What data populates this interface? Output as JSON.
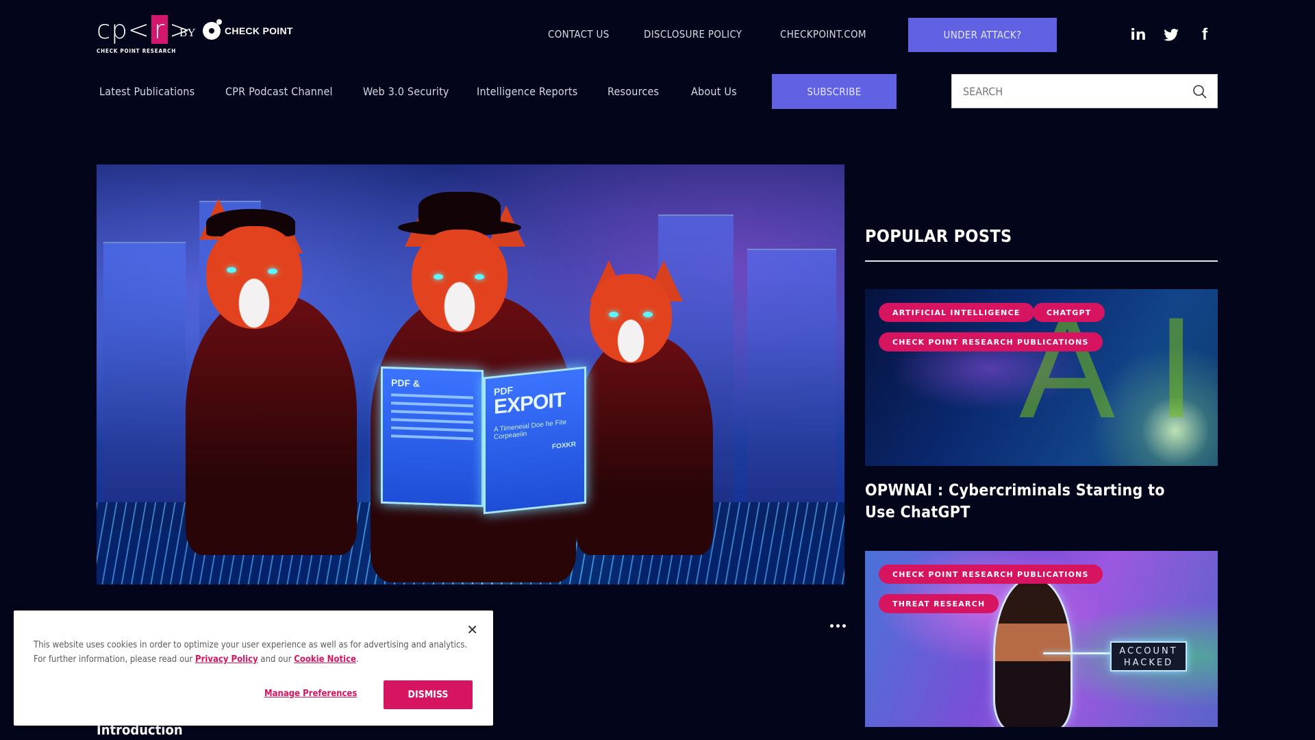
{
  "brand": {
    "logo_text_prefix": "cp<",
    "logo_text_r": "r",
    "logo_text_suffix": ">",
    "logo_subtitle": "CHECK POINT RESEARCH",
    "by_label": "BY",
    "partner_name": "CHECK POINT"
  },
  "top_links": [
    {
      "label": "CONTACT US"
    },
    {
      "label": "DISCLOSURE POLICY"
    },
    {
      "label": "CHECKPOINT.COM"
    }
  ],
  "under_attack_label": "UNDER ATTACK?",
  "social": [
    {
      "icon": "linkedin-icon",
      "glyph": "in"
    },
    {
      "icon": "twitter-icon",
      "glyph": ""
    },
    {
      "icon": "facebook-icon",
      "glyph": "f"
    }
  ],
  "nav": {
    "items": [
      {
        "label": "Latest Publications"
      },
      {
        "label": "CPR Podcast Channel"
      },
      {
        "label": "Web 3.0 Security"
      },
      {
        "label": "Intelligence Reports"
      },
      {
        "label": "Resources"
      },
      {
        "label": "About Us"
      }
    ],
    "subscribe_label": "SUBSCRIBE",
    "search_placeholder": "SEARCH"
  },
  "hero": {
    "booklet_left_title": "PDF &",
    "booklet_right_kicker": "PDF",
    "booklet_right_title": "EXPOIT",
    "booklet_right_sub": "A Timeneial Doe he Fite Corpeaeiin",
    "booklet_right_brand": "FOXKR"
  },
  "article": {
    "section_heading": "Introduction"
  },
  "sidebar": {
    "title": "POPULAR POSTS",
    "posts": [
      {
        "tags": [
          "ARTIFICIAL INTELLIGENCE",
          "CHATGPT",
          "CHECK POINT RESEARCH PUBLICATIONS"
        ],
        "image_text": "AI",
        "title": "OPWNAI : Cybercriminals Starting to Use ChatGPT"
      },
      {
        "tags": [
          "CHECK POINT RESEARCH PUBLICATIONS",
          "THREAT RESEARCH"
        ],
        "image_text_line1": "ACCOUNT",
        "image_text_line2": "HACKED"
      }
    ]
  },
  "cookie": {
    "close_glyph": "✕",
    "message_prefix": "This website uses cookies in order to optimize your user experience as well as for advertising and analytics.  For further information, please read our ",
    "privacy_link": "Privacy Policy",
    "message_mid": " and our ",
    "cookie_link": "Cookie Notice",
    "message_suffix": ".",
    "manage_label": "Manage Preferences",
    "dismiss_label": "DISMISS"
  },
  "colors": {
    "background": "#03061a",
    "accent_purple": "#6062e3",
    "accent_pink": "#d6145f"
  }
}
